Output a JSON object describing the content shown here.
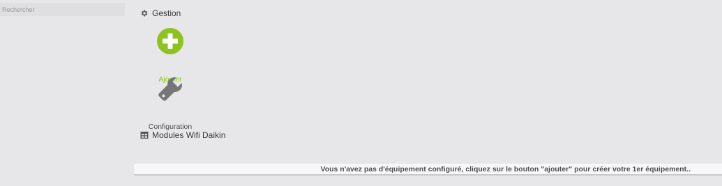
{
  "sidebar": {
    "search": {
      "placeholder": "Rechercher",
      "value": ""
    }
  },
  "gestion": {
    "title": "Gestion",
    "icon": "gear-icon",
    "actions": [
      {
        "label": "Ajouter",
        "icon": "plus-circle-icon",
        "color": "#8dc21f"
      },
      {
        "label": "Configuration",
        "icon": "wrench-icon",
        "color": "#767676"
      }
    ]
  },
  "modules": {
    "title": "Modules Wifi Daikin",
    "icon": "table-icon"
  },
  "empty_message": "Vous n'avez pas d'équipement configuré, cliquez sur le bouton \"ajouter\" pour créer votre 1er équipement.."
}
